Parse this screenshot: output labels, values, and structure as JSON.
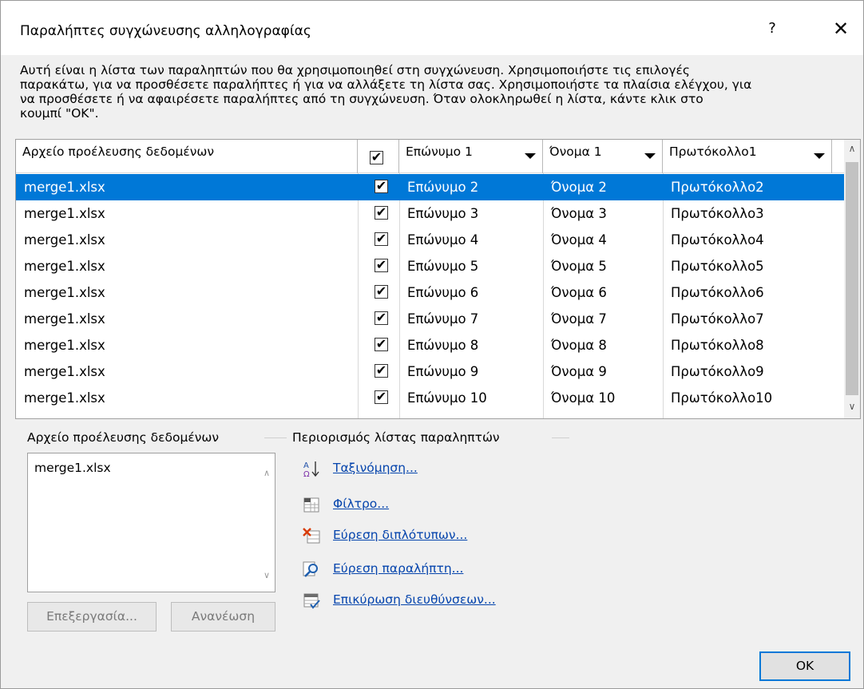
{
  "window": {
    "title": "Παραλήπτες συγχώνευσης αλληλογραφίας",
    "help": "?",
    "close": "✕"
  },
  "intro": "Αυτή είναι η λίστα των παραληπτών που θα χρησιμοποιηθεί στη συγχώνευση. Χρησιμοποιήστε τις επιλογές\nπαρακάτω, για να προσθέσετε παραλήπτες ή για να αλλάξετε τη λίστα σας. Χρησιμοποιήστε τα πλαίσια ελέγχου, για\nνα προσθέσετε ή να αφαιρέσετε παραλήπτες από τη συγχώνευση. Όταν ολοκληρωθεί η λίστα, κάντε κλικ στο\nκουμπί \"OK\".",
  "grid": {
    "headers": {
      "source": "Αρχείο προέλευσης δεδομένων",
      "check": "✔",
      "surname": "Επώνυμο 1",
      "name": "Όνομα 1",
      "protocol": "Πρωτόκολλο1"
    },
    "rows": [
      {
        "source": "merge1.xlsx",
        "checked": "✔",
        "surname": "Επώνυμο 2",
        "name": "Όνομα 2",
        "protocol": "Πρωτόκολλο2"
      },
      {
        "source": "merge1.xlsx",
        "checked": "✔",
        "surname": "Επώνυμο 3",
        "name": "Όνομα 3",
        "protocol": "Πρωτόκολλο3"
      },
      {
        "source": "merge1.xlsx",
        "checked": "✔",
        "surname": "Επώνυμο 4",
        "name": "Όνομα 4",
        "protocol": "Πρωτόκολλο4"
      },
      {
        "source": "merge1.xlsx",
        "checked": "✔",
        "surname": "Επώνυμο 5",
        "name": "Όνομα 5",
        "protocol": "Πρωτόκολλο5"
      },
      {
        "source": "merge1.xlsx",
        "checked": "✔",
        "surname": "Επώνυμο 6",
        "name": "Όνομα 6",
        "protocol": "Πρωτόκολλο6"
      },
      {
        "source": "merge1.xlsx",
        "checked": "✔",
        "surname": "Επώνυμο 7",
        "name": "Όνομα 7",
        "protocol": "Πρωτόκολλο7"
      },
      {
        "source": "merge1.xlsx",
        "checked": "✔",
        "surname": "Επώνυμο 8",
        "name": "Όνομα 8",
        "protocol": "Πρωτόκολλο8"
      },
      {
        "source": "merge1.xlsx",
        "checked": "✔",
        "surname": "Επώνυμο 9",
        "name": "Όνομα 9",
        "protocol": "Πρωτόκολλο9"
      },
      {
        "source": "merge1.xlsx",
        "checked": "✔",
        "surname": "Επώνυμο 10",
        "name": "Όνομα 10",
        "protocol": "Πρωτόκολλο10"
      }
    ],
    "selected_row": 0
  },
  "data_source": {
    "title": "Αρχείο προέλευσης δεδομένων",
    "items": [
      "merge1.xlsx"
    ],
    "edit_label": "Επεξεργασία...",
    "refresh_label": "Ανανέωση"
  },
  "refine": {
    "title": "Περιορισμός λίστας παραληπτών",
    "links": [
      {
        "label": "Ταξινόμηση...",
        "icon": "sort-az-icon"
      },
      {
        "label": "Φίλτρο...",
        "icon": "filter-icon"
      },
      {
        "label": "Εύρεση διπλότυπων...",
        "icon": "find-duplicates-icon"
      },
      {
        "label": "Εύρεση παραλήπτη...",
        "icon": "find-recipient-icon"
      },
      {
        "label": "Επικύρωση διευθύνσεων...",
        "icon": "validate-addresses-icon"
      }
    ]
  },
  "ok_label": "OK",
  "colors": {
    "selection": "#0078d7",
    "link": "#0645ad"
  }
}
